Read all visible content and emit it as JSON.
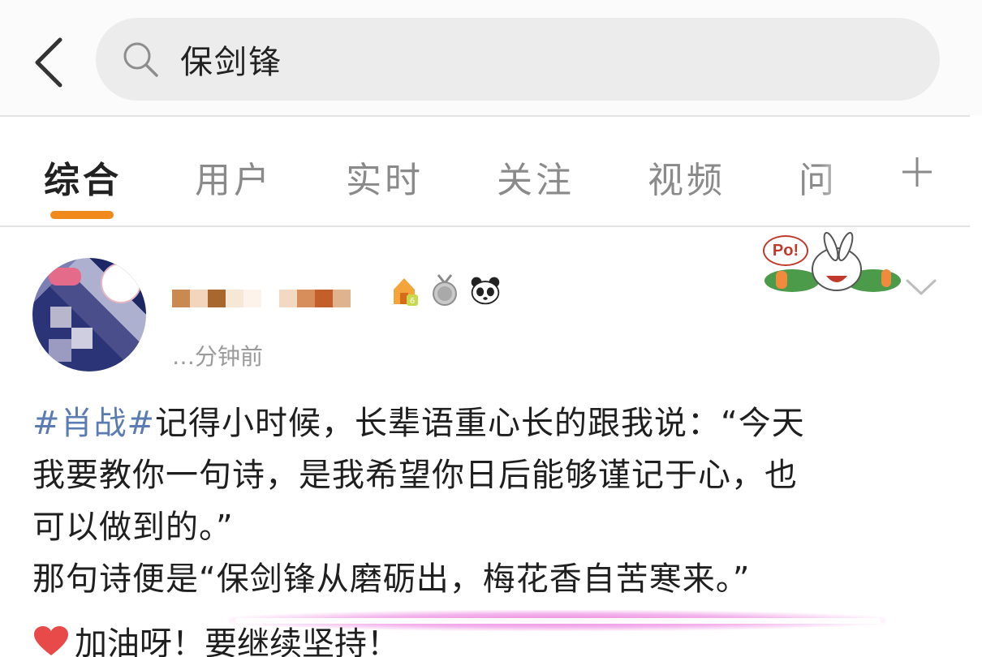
{
  "search": {
    "query": "保剑锋"
  },
  "tabs": [
    {
      "label": "综合",
      "active": true
    },
    {
      "label": "用户",
      "active": false
    },
    {
      "label": "实时",
      "active": false
    },
    {
      "label": "关注",
      "active": false
    },
    {
      "label": "视频",
      "active": false
    },
    {
      "label": "问",
      "active": false
    }
  ],
  "post": {
    "time": "…分钟前",
    "sticker_text": "Po!",
    "hashtag": "#肖战#",
    "line1_rest": "记得小时候，长辈语重心长的跟我说：“今天",
    "line2": "我要教你一句诗，是我希望你日后能够谨记于心，也",
    "line3": "可以做到的。”",
    "line4_prefix": "那句诗便是",
    "line4_quote": "“保剑锋从磨砺出，梅花香自苦寒来。”",
    "line5": "加油呀！要继续坚持！"
  },
  "colors": {
    "accent_underline": "#f08a1c",
    "hashtag": "#5b7bb3",
    "highlight": "#ea78dc"
  },
  "icons": [
    "back-arrow-icon",
    "search-icon",
    "plus-icon",
    "chevron-down-icon",
    "heart-icon"
  ]
}
